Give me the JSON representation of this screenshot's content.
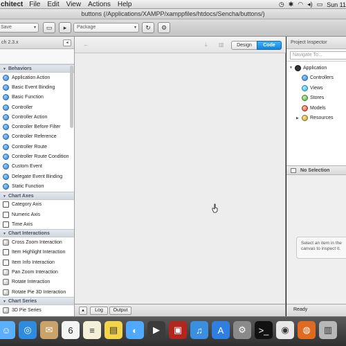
{
  "menubar": {
    "app": "chitect",
    "menus": [
      "File",
      "Edit",
      "View",
      "Actions",
      "Help"
    ],
    "clock": "Sun 11"
  },
  "window": {
    "title": "buttons (/Applications/XAMPP/xamppfiles/htdocs/Sencha/buttons/)"
  },
  "toolbar": {
    "save_select": "Save",
    "package_select": "Package"
  },
  "toolbox": {
    "header": "ch 2.3.x",
    "groups": [
      {
        "label": "Behaviors",
        "items": [
          {
            "label": "Application Action",
            "icon": "blue"
          },
          {
            "label": "Basic Event Binding",
            "icon": "blue"
          },
          {
            "label": "Basic Function",
            "icon": "blue"
          },
          {
            "label": "Controller",
            "icon": "blue"
          },
          {
            "label": "Controller Action",
            "icon": "blue"
          },
          {
            "label": "Controller Before Filter",
            "icon": "blue"
          },
          {
            "label": "Controller Reference",
            "icon": "blue"
          },
          {
            "label": "Controller Route",
            "icon": "blue"
          },
          {
            "label": "Controller Route Condition",
            "icon": "blue"
          },
          {
            "label": "Custom Event",
            "icon": "blue"
          },
          {
            "label": "Delegate Event Binding",
            "icon": "blue"
          },
          {
            "label": "Static Function",
            "icon": "blue"
          }
        ]
      },
      {
        "label": "Chart Axes",
        "items": [
          {
            "label": "Category Axis",
            "icon": "sq"
          },
          {
            "label": "Numeric Axis",
            "icon": "sq"
          },
          {
            "label": "Time Axis",
            "icon": "sq"
          }
        ]
      },
      {
        "label": "Chart Interactions",
        "items": [
          {
            "label": "Cross Zoom Interaction",
            "icon": "gray"
          },
          {
            "label": "Item Highlight Interaction",
            "icon": "sq"
          },
          {
            "label": "Item Info Interaction",
            "icon": "sq"
          },
          {
            "label": "Pan Zoom Interaction",
            "icon": "gray"
          },
          {
            "label": "Rotate Interaction",
            "icon": "gray"
          },
          {
            "label": "Rotate Pie 3D Interaction",
            "icon": "gray"
          }
        ]
      },
      {
        "label": "Chart Series",
        "items": [
          {
            "label": "3D Pie Series",
            "icon": "gray"
          }
        ]
      }
    ]
  },
  "canvas": {
    "design_tab": "Design",
    "code_tab": "Code",
    "log_tab": "Log",
    "output_tab": "Output"
  },
  "inspector": {
    "header": "Project Inspector",
    "navigate_placeholder": "Navigate To...",
    "tree": [
      {
        "label": "Application",
        "icon": "app",
        "level": 0,
        "expanded": true
      },
      {
        "label": "Controllers",
        "icon": "ctrl",
        "level": 1
      },
      {
        "label": "Views",
        "icon": "views",
        "level": 1
      },
      {
        "label": "Stores",
        "icon": "stores",
        "level": 1
      },
      {
        "label": "Models",
        "icon": "models",
        "level": 1
      },
      {
        "label": "Resources",
        "icon": "res",
        "level": 1,
        "collapsed": true
      }
    ],
    "selection_header": "No Selection",
    "hint": "Select an item in the canvas to inspect it.",
    "status": "Ready"
  },
  "dock": {
    "icons": [
      "finder-icon",
      "safari-icon",
      "mail-icon",
      "calendar-icon",
      "notes-icon",
      "stickies-icon",
      "messages-icon",
      "facetime-icon",
      "photobooth-icon",
      "itunes-icon",
      "appstore-icon",
      "system-prefs-icon",
      "terminal-icon",
      "chrome-icon",
      "firefox-icon",
      "trash-icon"
    ],
    "calendar_day": "6"
  }
}
